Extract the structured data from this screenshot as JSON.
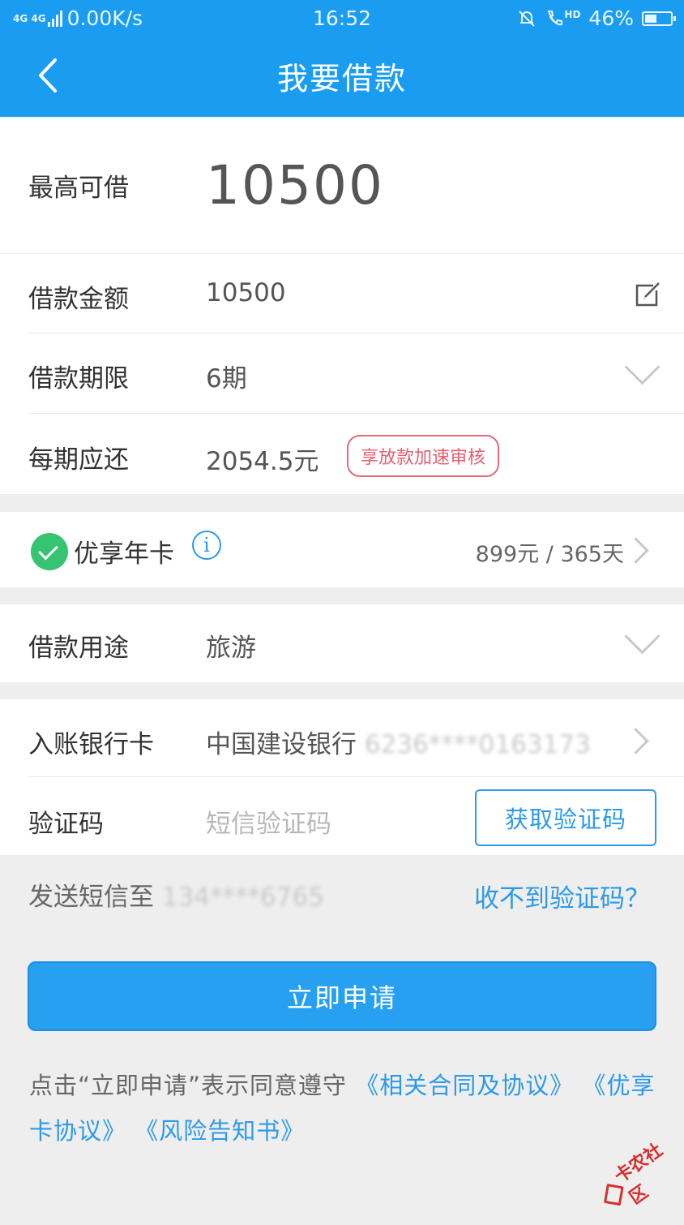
{
  "status_bar": {
    "network_label": "4G 4G",
    "speed": "0.00K/s",
    "time": "16:52",
    "hd_label": "HD",
    "battery": "46%",
    "battery_level": 0.46
  },
  "nav": {
    "title": "我要借款"
  },
  "max_borrow": {
    "label": "最高可借",
    "value": "10500"
  },
  "loan": {
    "amount_label": "借款金额",
    "amount_value": "10500",
    "term_label": "借款期限",
    "term_value": "6期",
    "repay_label": "每期应还",
    "repay_value": "2054.5元",
    "badge": "享放款加速审核"
  },
  "card": {
    "name": "优享年卡",
    "info_symbol": "i",
    "price": "899元 / 365天"
  },
  "purpose": {
    "label": "借款用途",
    "value": "旅游"
  },
  "bank": {
    "label": "入账银行卡",
    "bank_name": "中国建设银行",
    "card_masked": "6236****0163173"
  },
  "verify": {
    "label": "验证码",
    "placeholder": "短信验证码",
    "get_code_button": "获取验证码"
  },
  "sms": {
    "send_to_label": "发送短信至",
    "phone_masked": "134****6765",
    "help_link": "收不到验证码？"
  },
  "apply_button": "立即申请",
  "agreement": {
    "prefix": "点击“立即申请”表示同意遵守",
    "link1": "《相关合同及协议》",
    "link2": "《优享卡协议》",
    "link3": "《风险告知书》"
  },
  "watermark": {
    "text": "卡农社区"
  },
  "colors": {
    "primary": "#1a9df0",
    "success": "#37c472",
    "badge": "#e36b7b",
    "link": "#2c9ae8"
  }
}
